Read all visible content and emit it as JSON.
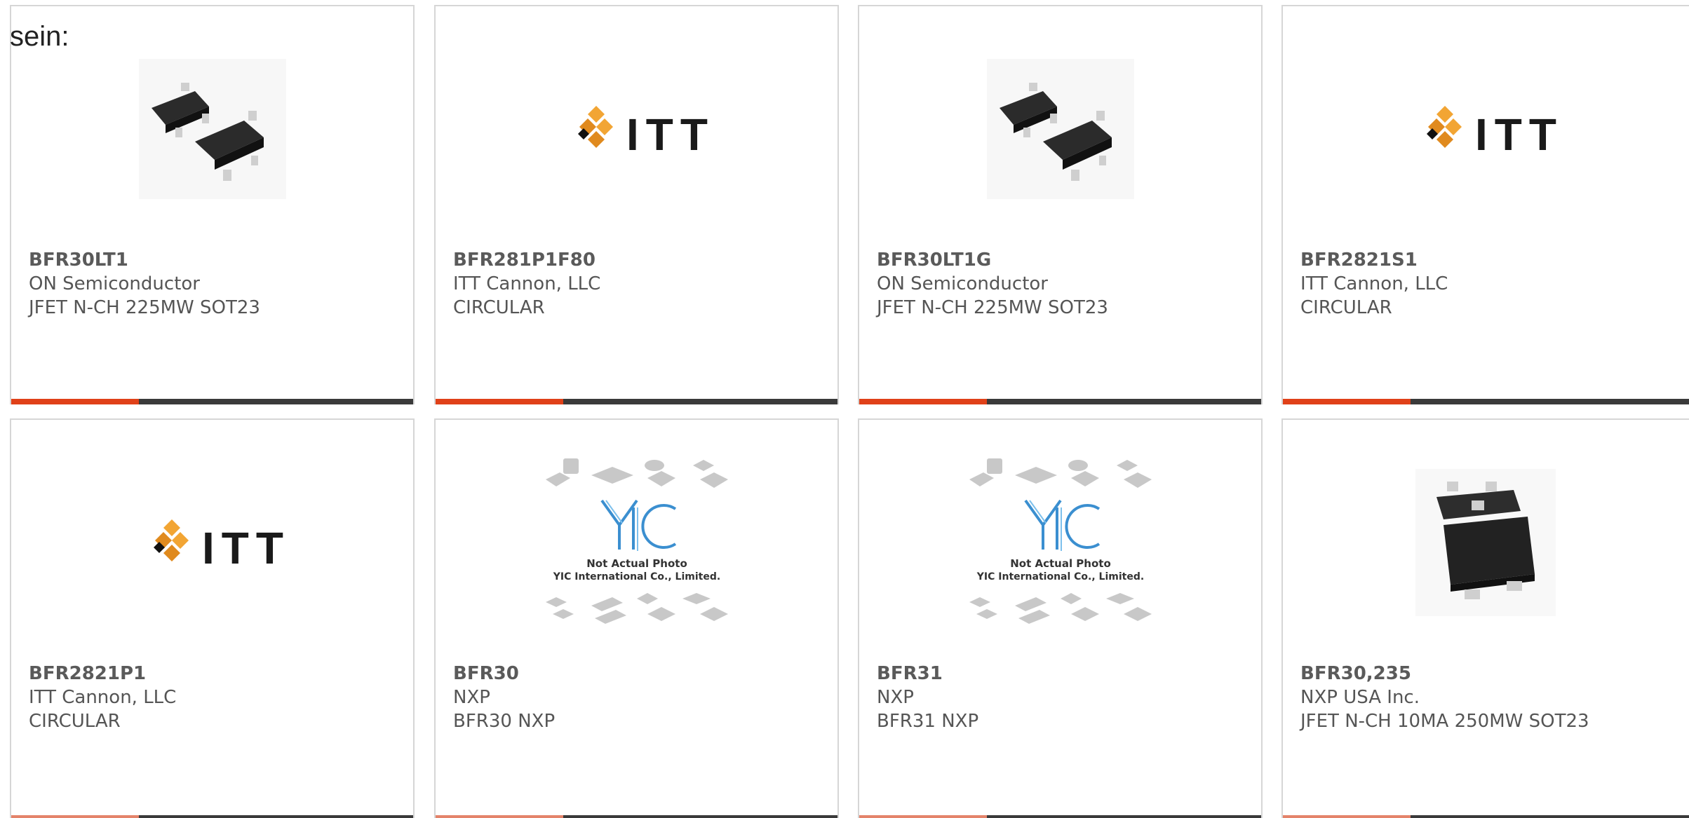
{
  "heading": "sein:",
  "accent_color": "#e04119",
  "cards": [
    {
      "part": "BFR30LT1",
      "maker": "ON Semiconductor",
      "desc": "JFET N-CH 225MW SOT23",
      "image": "sot23-pair-photo"
    },
    {
      "part": "BFR281P1F80",
      "maker": "ITT Cannon, LLC",
      "desc": "CIRCULAR",
      "image": "itt-logo",
      "logo_text": "ITT"
    },
    {
      "part": "BFR30LT1G",
      "maker": "ON Semiconductor",
      "desc": "JFET N-CH 225MW SOT23",
      "image": "sot23-pair-photo"
    },
    {
      "part": "BFR2821S1",
      "maker": "ITT Cannon, LLC",
      "desc": "CIRCULAR",
      "image": "itt-logo",
      "logo_text": "ITT"
    },
    {
      "part": "BFR2821P1",
      "maker": "ITT Cannon, LLC",
      "desc": "CIRCULAR",
      "image": "itt-logo",
      "logo_text": "ITT"
    },
    {
      "part": "BFR30",
      "maker": "NXP",
      "desc": "BFR30 NXP",
      "image": "yic-placeholder",
      "logo_text": "YIC",
      "photo_note": "Not Actual Photo",
      "photo_company": "YIC International Co., Limited."
    },
    {
      "part": "BFR31",
      "maker": "NXP",
      "desc": "BFR31 NXP",
      "image": "yic-placeholder",
      "logo_text": "YIC",
      "photo_note": "Not Actual Photo",
      "photo_company": "YIC International Co., Limited."
    },
    {
      "part": "BFR30,235",
      "maker": "NXP USA Inc.",
      "desc": "JFET N-CH 10MA 250MW SOT23",
      "image": "sot23-single-photo"
    }
  ]
}
